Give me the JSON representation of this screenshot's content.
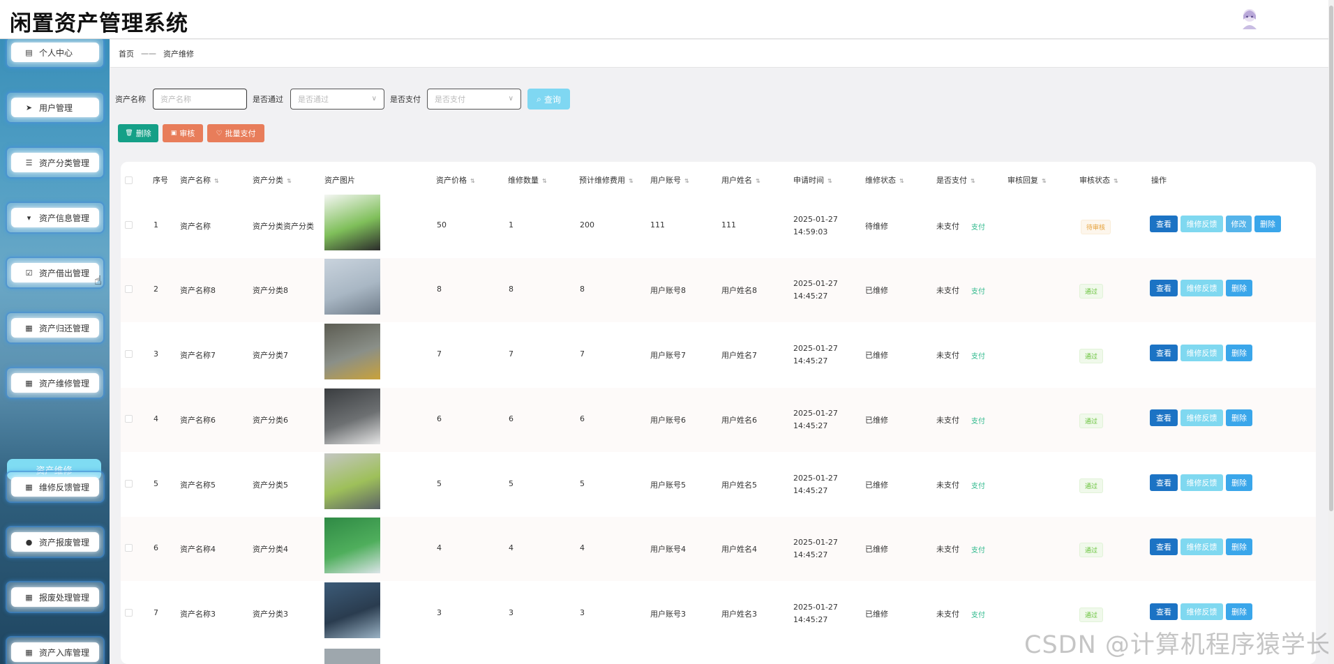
{
  "app": {
    "title": "闲置资产管理系统"
  },
  "sidebar": {
    "items": [
      {
        "label": "个人中心",
        "icon": "calendar-icon"
      },
      {
        "label": "用户管理",
        "icon": "send-icon"
      },
      {
        "label": "资产分类管理",
        "icon": "list-icon"
      },
      {
        "label": "资产信息管理",
        "icon": "pin-icon"
      },
      {
        "label": "资产借出管理",
        "icon": "check-square-icon"
      },
      {
        "label": "资产归还管理",
        "icon": "grid-icon"
      },
      {
        "label": "资产维修管理",
        "icon": "grid-icon"
      },
      {
        "label": "维修反馈管理",
        "icon": "grid-icon"
      },
      {
        "label": "资产报废管理",
        "icon": "user-icon"
      },
      {
        "label": "报废处理管理",
        "icon": "grid-icon"
      },
      {
        "label": "资产入库管理",
        "icon": "grid-icon"
      }
    ],
    "active_sub": "资产维修"
  },
  "breadcrumb": {
    "home": "首页",
    "separator": "——",
    "current": "资产维修"
  },
  "search": {
    "name_label": "资产名称",
    "name_placeholder": "资产名称",
    "pass_label": "是否通过",
    "pass_placeholder": "是否通过",
    "pay_label": "是否支付",
    "pay_placeholder": "是否支付",
    "query_label": "查询"
  },
  "actions": {
    "delete": "删除",
    "audit": "审核",
    "batch_pay": "批量支付"
  },
  "table": {
    "headers": [
      "序号",
      "资产名称",
      "资产分类",
      "资产图片",
      "资产价格",
      "维修数量",
      "预计维修费用",
      "用户账号",
      "用户姓名",
      "申请时间",
      "维修状态",
      "是否支付",
      "审核回复",
      "审核状态",
      "操作"
    ],
    "rows": [
      {
        "no": "1",
        "name": "资产名称",
        "category": "资产分类资产分类",
        "price": "50",
        "qty": "1",
        "cost": "200",
        "account": "111",
        "username": "111",
        "time": "2025-01-27 14:59:03",
        "repair_status": "待维修",
        "paid": "未支付",
        "pay_link": "支付",
        "reply": "",
        "audit": "待审核",
        "buttons": [
          "查看",
          "维修反馈",
          "修改",
          "删除"
        ]
      },
      {
        "no": "2",
        "name": "资产名称8",
        "category": "资产分类8",
        "price": "8",
        "qty": "8",
        "cost": "8",
        "account": "用户账号8",
        "username": "用户姓名8",
        "time": "2025-01-27 14:45:27",
        "repair_status": "已维修",
        "paid": "未支付",
        "pay_link": "支付",
        "reply": "",
        "audit": "通过",
        "buttons": [
          "查看",
          "维修反馈",
          "删除"
        ]
      },
      {
        "no": "3",
        "name": "资产名称7",
        "category": "资产分类7",
        "price": "7",
        "qty": "7",
        "cost": "7",
        "account": "用户账号7",
        "username": "用户姓名7",
        "time": "2025-01-27 14:45:27",
        "repair_status": "已维修",
        "paid": "未支付",
        "pay_link": "支付",
        "reply": "",
        "audit": "通过",
        "buttons": [
          "查看",
          "维修反馈",
          "删除"
        ]
      },
      {
        "no": "4",
        "name": "资产名称6",
        "category": "资产分类6",
        "price": "6",
        "qty": "6",
        "cost": "6",
        "account": "用户账号6",
        "username": "用户姓名6",
        "time": "2025-01-27 14:45:27",
        "repair_status": "已维修",
        "paid": "未支付",
        "pay_link": "支付",
        "reply": "",
        "audit": "通过",
        "buttons": [
          "查看",
          "维修反馈",
          "删除"
        ]
      },
      {
        "no": "5",
        "name": "资产名称5",
        "category": "资产分类5",
        "price": "5",
        "qty": "5",
        "cost": "5",
        "account": "用户账号5",
        "username": "用户姓名5",
        "time": "2025-01-27 14:45:27",
        "repair_status": "已维修",
        "paid": "未支付",
        "pay_link": "支付",
        "reply": "",
        "audit": "通过",
        "buttons": [
          "查看",
          "维修反馈",
          "删除"
        ]
      },
      {
        "no": "6",
        "name": "资产名称4",
        "category": "资产分类4",
        "price": "4",
        "qty": "4",
        "cost": "4",
        "account": "用户账号4",
        "username": "用户姓名4",
        "time": "2025-01-27 14:45:27",
        "repair_status": "已维修",
        "paid": "未支付",
        "pay_link": "支付",
        "reply": "",
        "audit": "通过",
        "buttons": [
          "查看",
          "维修反馈",
          "删除"
        ]
      },
      {
        "no": "7",
        "name": "资产名称3",
        "category": "资产分类3",
        "price": "3",
        "qty": "3",
        "cost": "3",
        "account": "用户账号3",
        "username": "用户姓名3",
        "time": "2025-01-27 14:45:27",
        "repair_status": "已维修",
        "paid": "未支付",
        "pay_link": "支付",
        "reply": "",
        "audit": "通过",
        "buttons": [
          "查看",
          "维修反馈",
          "删除"
        ]
      }
    ]
  },
  "watermark": "CSDN @计算机程序猿学长",
  "colors": {
    "primary": "#1c73c4",
    "feedback": "#7fd8f0",
    "delete_action": "#15a087",
    "audit_action": "#e87d5a",
    "pay_link": "#2bb88a"
  }
}
